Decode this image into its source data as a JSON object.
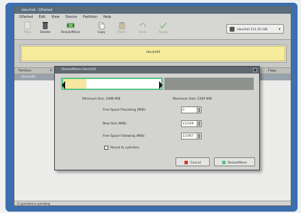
{
  "window": {
    "title": "/dev/hdl - GParted"
  },
  "menu": {
    "items": [
      "GParted",
      "Edit",
      "View",
      "Device",
      "Partition",
      "Help"
    ]
  },
  "toolbar": {
    "new": "New",
    "delete": "Delete",
    "resize_move": "Resize/Move",
    "copy": "Copy",
    "paste": "Paste",
    "undo": "Undo",
    "apply": "Apply"
  },
  "device": {
    "label": "/dev/hdl  111.16 GiB"
  },
  "disk_graphic": {
    "label": "/dev/hdl1"
  },
  "partition_list": {
    "headers": [
      "Partition",
      "Fi",
      "Flags"
    ],
    "row": "/dev/hdl1"
  },
  "status": {
    "text": "0 operations pending"
  },
  "dialog": {
    "title": "Resize/Move /dev/hdl1",
    "min_size": "Minimum Size: 2098 MiB",
    "max_size": "Maximum Size: 2300 MiB",
    "free_preceding_label": "Free Space Preceding (MiB):",
    "free_preceding_value": "0",
    "new_size_label": "New Size (MiB):",
    "new_size_value": "111109",
    "free_following_label": "Free Space Following (MiB):",
    "free_following_value": "111957",
    "round_label": "Round to cylinders",
    "cancel_label": "Cancel",
    "resize_label": "Resize/Move"
  },
  "colors": {
    "screen_bg": "#3d6fae",
    "partition_outline": "#56c383",
    "used_space": "#f6e6a0",
    "unallocated": "#8f918f",
    "disk_bar": "#f6ec9c"
  }
}
